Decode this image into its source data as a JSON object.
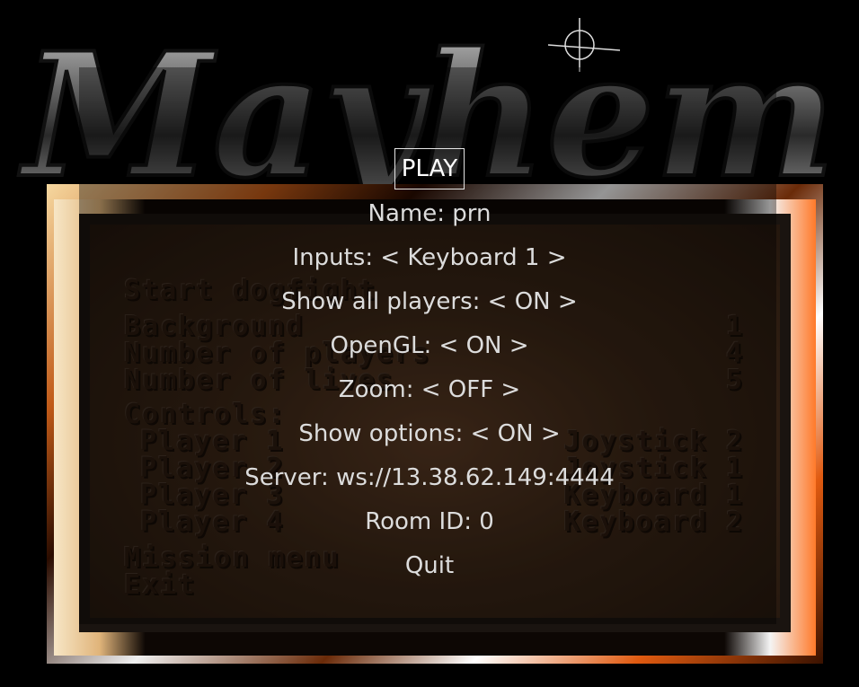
{
  "background": {
    "logo_text": "Mayhem",
    "legacy_menu": {
      "items": [
        "Start dogfight",
        "Background",
        "Number of players",
        "Number of lives",
        "Controls:",
        "Player 1",
        "Player 2",
        "Player 3",
        "Player 4",
        "Mission menu",
        "Exit"
      ],
      "values": [
        "1",
        "4",
        "5",
        "Joystick 2",
        "Joystick 1",
        "Keyboard 1",
        "Keyboard 2"
      ]
    },
    "colors": {
      "frame_orange": "#e05a10",
      "inner_brown": "#3a2616",
      "menu_text": "#dcdcdc"
    }
  },
  "menu": {
    "play": "PLAY",
    "name": "Name: prn",
    "inputs": "Inputs: < Keyboard 1 >",
    "show_all_players": "Show all players: < ON >",
    "opengl": "OpenGL: < ON >",
    "zoom": "Zoom: < OFF >",
    "show_options": "Show options: < ON >",
    "server": "Server: ws://13.38.62.149:4444",
    "room_id": "Room ID: 0",
    "quit": "Quit"
  }
}
